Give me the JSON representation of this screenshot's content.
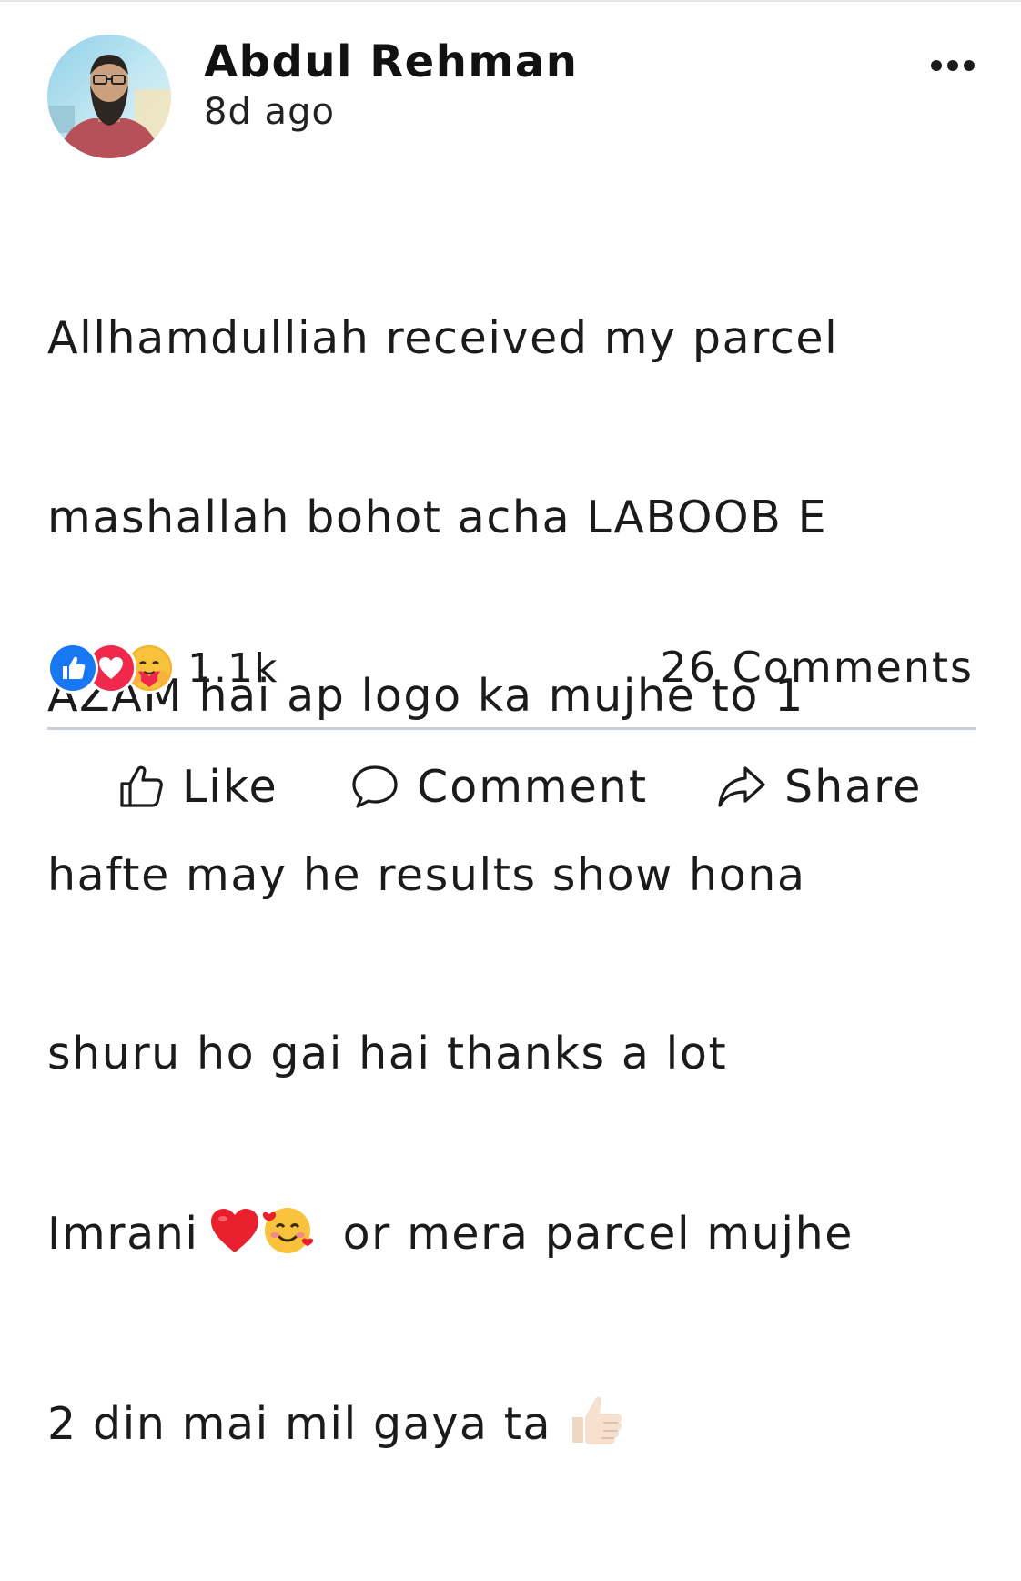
{
  "post": {
    "author_name": "Abdul Rehman",
    "timestamp": "8d ago",
    "more_icon": "more-horizontal-icon",
    "body_lines": [
      "Allhamdulliah received my parcel",
      "mashallah bohot acha LABOOB E",
      "AZAM hai ap logo ka mujhe to 1",
      "hafte may he results show hona",
      "shuru ho gai hai thanks a lot",
      "Imrani",
      " or mera parcel mujhe",
      "2 din mai mil gaya ta "
    ],
    "reactions": {
      "icons": [
        "like-reaction-icon",
        "love-reaction-icon",
        "care-reaction-icon"
      ],
      "count": "1.1k"
    },
    "comments_count": "26 Comments",
    "actions": {
      "like_label": "Like",
      "comment_label": "Comment",
      "share_label": "Share"
    },
    "colors": {
      "like_blue": "#1877f2",
      "love_red": "#f0284a",
      "care_yellow": "#f7b125",
      "divider": "#c9cfd8"
    }
  }
}
